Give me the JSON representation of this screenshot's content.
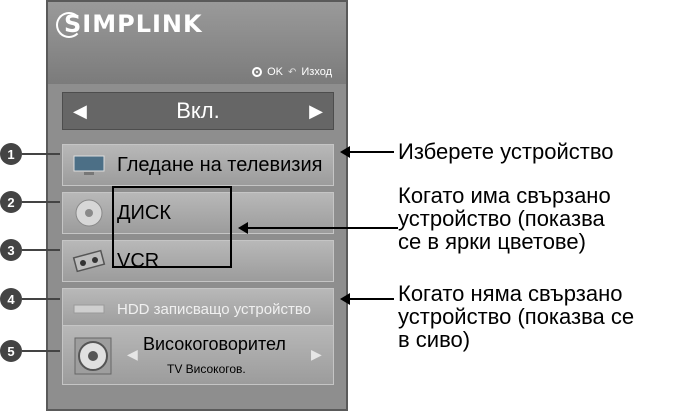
{
  "header": {
    "brand": "SIMPLINK",
    "ok_label": "OK",
    "exit_label": "Изход"
  },
  "mode": {
    "label": "Вкл."
  },
  "items": [
    {
      "num": "1",
      "label": "Гледане на телевизия",
      "icon": "tv-icon"
    },
    {
      "num": "2",
      "label": "ДИСК",
      "icon": "disc-icon"
    },
    {
      "num": "3",
      "label": "VCR",
      "icon": "vcr-icon"
    },
    {
      "num": "4",
      "label": "HDD записващо устройство",
      "icon": "hdd-icon"
    }
  ],
  "speaker": {
    "num": "5",
    "title": "Високоговорител",
    "subtitle": "TV Високогов."
  },
  "callouts": {
    "select_device": "Изберете устройство",
    "connected_1": "Когато има свързано",
    "connected_2": "устройство (показва",
    "connected_3": "се в ярки цветове)",
    "not_connected_1": "Когато няма свързано",
    "not_connected_2": "устройство (показва се",
    "not_connected_3": "в сиво)"
  }
}
